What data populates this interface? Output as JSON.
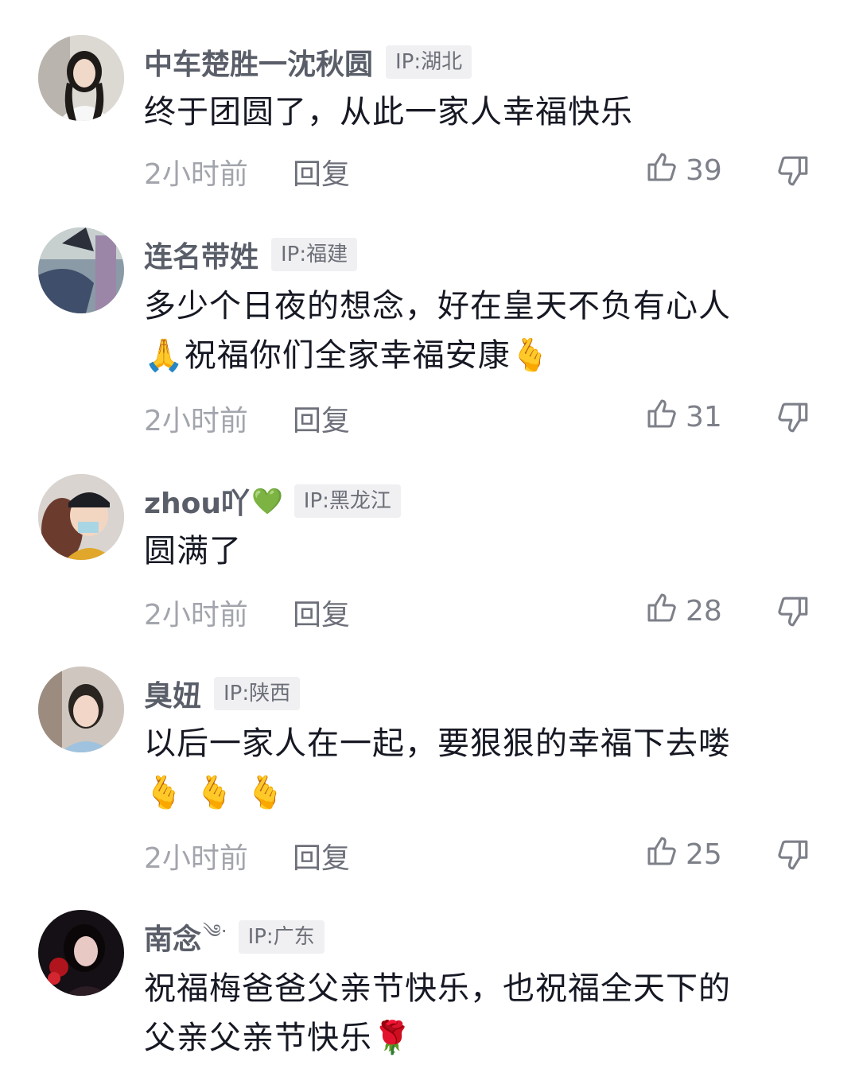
{
  "comments": [
    {
      "username": "中车楚胜一沈秋圆",
      "username_emoji": "",
      "ip": "IP:湖北",
      "lines": [
        "终于团圆了，从此一家人幸福快乐"
      ],
      "time": "2小时前",
      "reply": "回复",
      "likes": "39",
      "avatar_icon": "avatar-woman-photo"
    },
    {
      "username": "连名带姓",
      "username_emoji": "",
      "ip": "IP:福建",
      "lines": [
        "多少个日夜的想念，好在皇天不负有心人",
        "🙏祝福你们全家幸福安康🫰"
      ],
      "time": "2小时前",
      "reply": "回复",
      "likes": "31",
      "avatar_icon": "avatar-photo"
    },
    {
      "username": "zhou吖",
      "username_emoji": "💚",
      "ip": "IP:黑龙江",
      "lines": [
        "圆满了"
      ],
      "time": "2小时前",
      "reply": "回复",
      "likes": "28",
      "avatar_icon": "avatar-child-photo"
    },
    {
      "username": "臭妞",
      "username_emoji": "",
      "ip": "IP:陕西",
      "lines": [
        "以后一家人在一起，要狠狠的幸福下去喽",
        "🫰🫰🫰"
      ],
      "time": "2小时前",
      "reply": "回复",
      "likes": "25",
      "avatar_icon": "avatar-girl-photo"
    },
    {
      "username": "南念",
      "username_emoji": "༄·",
      "ip": "IP:广东",
      "lines": [
        "祝福梅爸爸父亲节快乐，也祝福全天下的",
        "父亲父亲节快乐🌹"
      ],
      "time": "",
      "reply": "",
      "likes": "",
      "avatar_icon": "avatar-anime-photo"
    }
  ]
}
